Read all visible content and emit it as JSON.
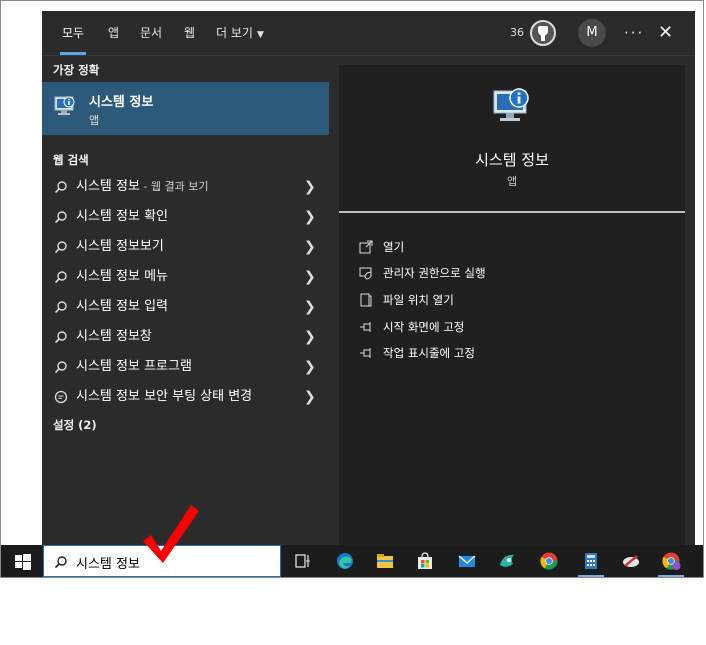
{
  "tabs": [
    {
      "label": "모두",
      "active": true
    },
    {
      "label": "앱"
    },
    {
      "label": "문서"
    },
    {
      "label": "웹"
    },
    {
      "label": "더 보기"
    }
  ],
  "header": {
    "points": "36",
    "avatar_initial": "M",
    "more_label": "···",
    "close_label": "✕"
  },
  "left": {
    "best_match_title": "가장 정확",
    "best_match": {
      "name": "시스템 정보",
      "type": "앱"
    },
    "web_search_title": "웹 검색",
    "web_results": [
      {
        "text": "시스템 정보",
        "sub": " - 웹 결과 보기"
      },
      {
        "text": "시스템 정보 확인"
      },
      {
        "text": "시스템 정보보기"
      },
      {
        "text": "시스템 정보 메뉴"
      },
      {
        "text": "시스템 정보 입력"
      },
      {
        "text": "시스템 정보창"
      },
      {
        "text": "시스템 정보 프로그램"
      },
      {
        "text": "시스템 정보 보안 부팅 상태 변경"
      }
    ],
    "settings_title": "설정 (2)"
  },
  "right": {
    "title": "시스템 정보",
    "subtitle": "앱",
    "actions": [
      {
        "label": "열기",
        "icon": "open-icon"
      },
      {
        "label": "관리자 권한으로 실행",
        "icon": "admin-shield-icon"
      },
      {
        "label": "파일 위치 열기",
        "icon": "file-location-icon"
      },
      {
        "label": "시작 화면에 고정",
        "icon": "pin-icon"
      },
      {
        "label": "작업 표시줄에 고정",
        "icon": "pin-icon"
      }
    ]
  },
  "taskbar": {
    "search_value": "시스템 정보",
    "icons": [
      "windows-start-icon",
      "task-view-icon",
      "edge-icon",
      "file-explorer-icon",
      "store-icon",
      "mail-icon",
      "app-icon",
      "chrome-icon",
      "calculator-icon",
      "tool-icon",
      "chrome-profile-icon"
    ]
  },
  "colors": {
    "panel_bg": "#2b2b2b",
    "right_bg": "#202020",
    "selection": "#2d5a7b",
    "accent": "#5aa9e6",
    "taskbar": "#1c1c1c",
    "checkmark": "#ff0000"
  }
}
